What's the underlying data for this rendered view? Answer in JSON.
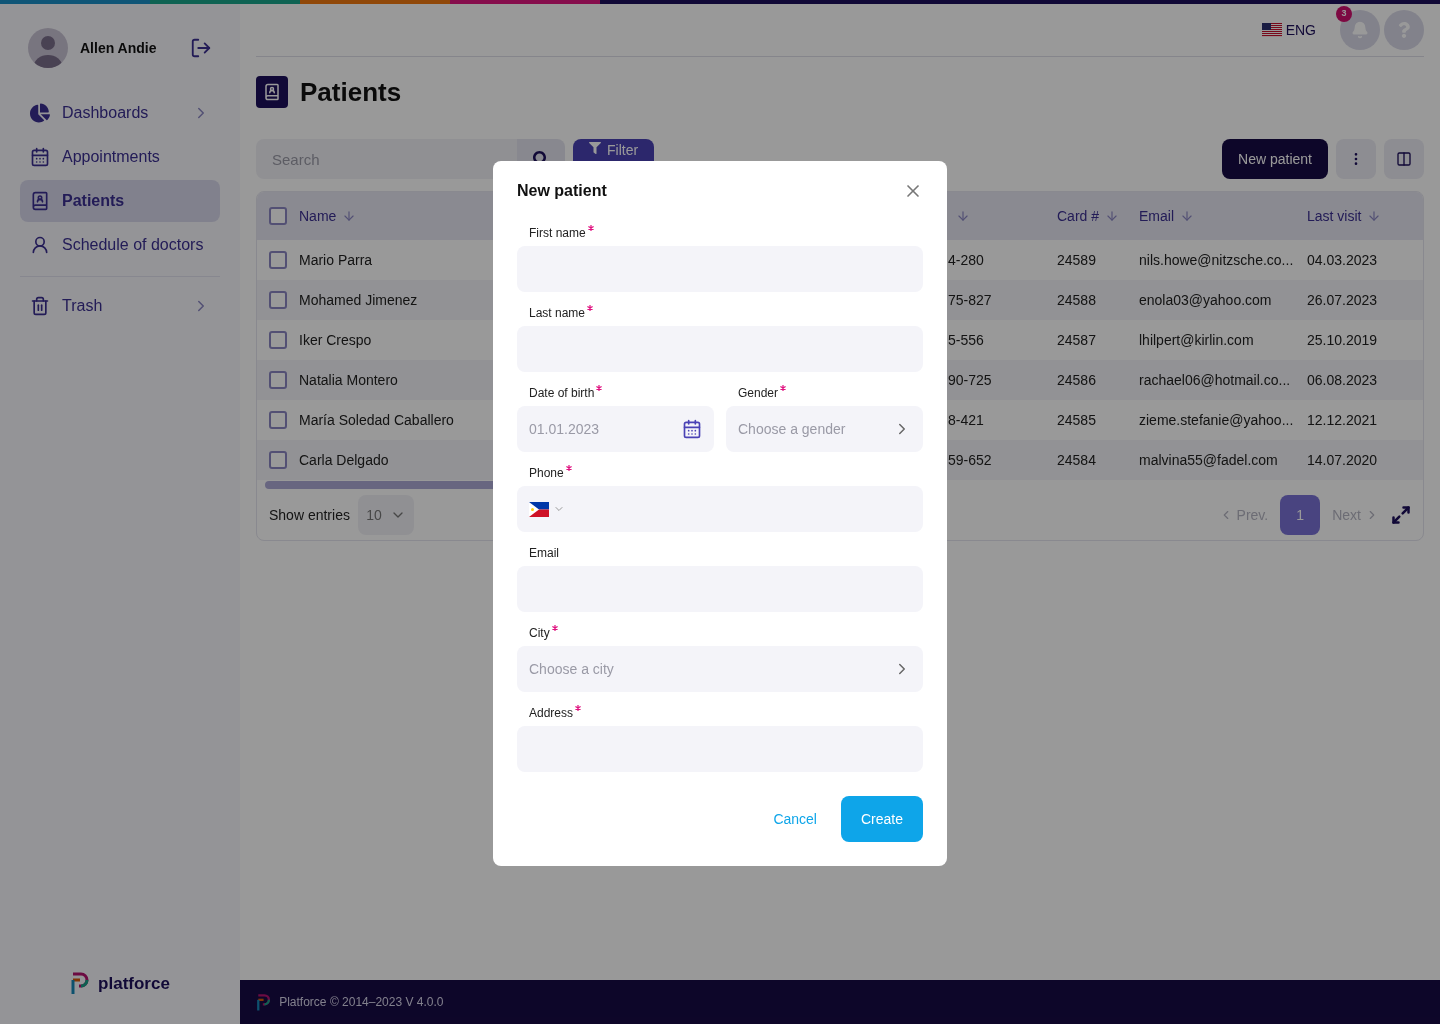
{
  "header": {
    "language": "ENG",
    "notifications": "3"
  },
  "user": {
    "name": "Allen Andie"
  },
  "sidebar": {
    "items": [
      {
        "label": "Dashboards",
        "selected": false,
        "expandable": true
      },
      {
        "label": "Appointments",
        "selected": false,
        "expandable": false
      },
      {
        "label": "Patients",
        "selected": true,
        "expandable": false
      },
      {
        "label": "Schedule of doctors",
        "selected": false,
        "expandable": false
      },
      {
        "label": "Trash",
        "selected": false,
        "expandable": true
      }
    ],
    "brand": "platforce"
  },
  "page": {
    "title": "Patients"
  },
  "toolbar": {
    "search_placeholder": "Search",
    "filter": "Filter",
    "new_button": "New patient"
  },
  "table": {
    "all_checked": false,
    "columns": [
      {
        "label": "Name"
      },
      {
        "label": "Card #"
      },
      {
        "label": "Email"
      },
      {
        "label": "Last visit"
      }
    ],
    "rows": [
      {
        "name": "Mario Parra",
        "phone": "4-280",
        "card": "24589",
        "email": "nils.howe@nitzsche.co...",
        "last_visit": "04.03.2023",
        "checked": false
      },
      {
        "name": "Mohamed Jimenez",
        "phone": "75-827",
        "card": "24588",
        "email": "enola03@yahoo.com",
        "last_visit": "26.07.2023",
        "checked": false
      },
      {
        "name": "Iker Crespo",
        "phone": "5-556",
        "card": "24587",
        "email": "lhilpert@kirlin.com",
        "last_visit": "25.10.2019",
        "checked": false
      },
      {
        "name": "Natalia Montero",
        "phone": "90-725",
        "card": "24586",
        "email": "rachael06@hotmail.co...",
        "last_visit": "06.08.2023",
        "checked": false
      },
      {
        "name": "María Soledad Caballero",
        "phone": "8-421",
        "card": "24585",
        "email": "zieme.stefanie@yahoo...",
        "last_visit": "12.12.2021",
        "checked": false
      },
      {
        "name": "Carla Delgado",
        "phone": "59-652",
        "card": "24584",
        "email": "malvina55@fadel.com",
        "last_visit": "14.07.2020",
        "checked": false
      }
    ]
  },
  "table_footer": {
    "show_entries": "Show entries",
    "entries": "10",
    "prev": "Prev.",
    "pages": [
      {
        "label": "1",
        "selected": true
      }
    ],
    "next": "Next"
  },
  "modal": {
    "title": "New patient",
    "fields": [
      {
        "kind": "text",
        "label": "First name",
        "required": true
      },
      {
        "kind": "text",
        "label": "Last name",
        "required": true
      },
      {
        "kind": "pair",
        "fields": [
          {
            "kind": "date",
            "label": "Date of birth",
            "required": true,
            "placeholder": "01.01.2023"
          },
          {
            "kind": "select",
            "label": "Gender",
            "required": true,
            "placeholder": "Choose a gender"
          }
        ]
      },
      {
        "kind": "phone",
        "label": "Phone",
        "required": true
      },
      {
        "kind": "text",
        "label": "Email",
        "required": false
      },
      {
        "kind": "select",
        "label": "City",
        "required": true,
        "placeholder": "Choose a city"
      },
      {
        "kind": "text",
        "label": "Address",
        "required": true
      }
    ],
    "cancel": "Cancel",
    "create": "Create"
  },
  "footer": {
    "text": "Platforce © 2014–2023 V 4.0.0"
  }
}
